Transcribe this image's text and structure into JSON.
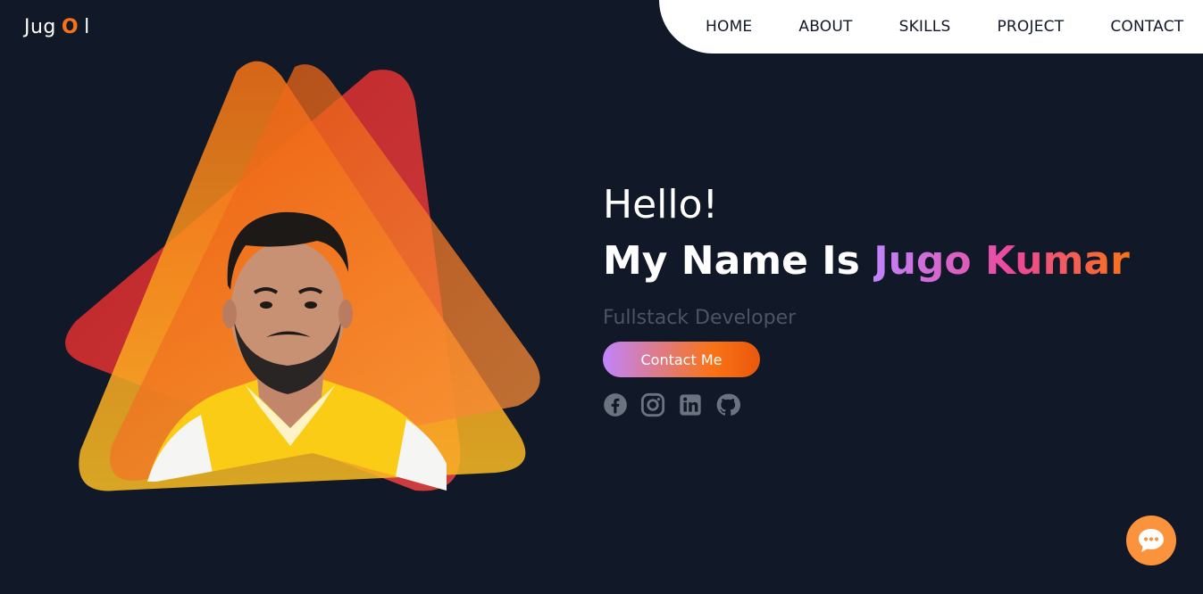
{
  "logo": {
    "part1": "Jug",
    "part2": "O",
    "part3": "l"
  },
  "nav": {
    "items": [
      "HOME",
      "ABOUT",
      "SKILLS",
      "PROJECT",
      "CONTACT"
    ]
  },
  "hero": {
    "greeting": "Hello!",
    "name_prefix": "My Name Is",
    "name": "Jugo Kumar",
    "role": "Fullstack Developer",
    "cta_label": "Contact Me"
  },
  "socials": [
    "facebook-icon",
    "instagram-icon",
    "linkedin-icon",
    "github-icon"
  ],
  "colors": {
    "background": "#111827",
    "accent": "#f97316",
    "nav_bg": "#ffffff",
    "chat_bg": "#fb923c"
  }
}
